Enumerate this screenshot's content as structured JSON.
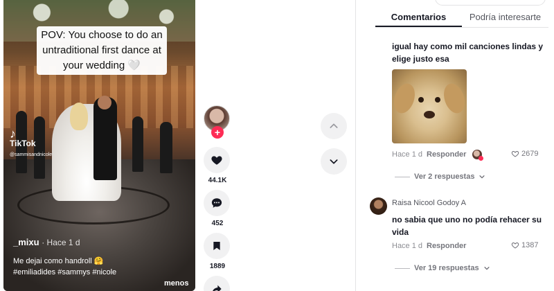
{
  "video": {
    "overlay_caption": "POV: You choose to do an untraditional first dance at your wedding 🤍",
    "watermark_brand": "TikTok",
    "watermark_handle": "@sammisandnicole",
    "author": "_mixu",
    "posted": "· Hace 1 d",
    "description_line1": "Me dejai como handroll 🤗",
    "description_line2": "#emiliadides #sammys #nicole",
    "more_label": "menos"
  },
  "actions": {
    "follow_badge": "+",
    "likes": "44.1K",
    "comments": "452",
    "saves": "1889"
  },
  "nav": {
    "up_icon": "chevron-up-icon",
    "down_icon": "chevron-down-icon"
  },
  "tabs": [
    {
      "label": "Comentarios"
    },
    {
      "label": "Podría interesarte"
    }
  ],
  "comments": [
    {
      "text": "igual hay como mil canciones lindas y elige justo esa",
      "image": "puppy-photo",
      "time": "Hace 1 d",
      "reply_label": "Responder",
      "likes": "2679",
      "view_replies": "Ver 2 respuestas"
    },
    {
      "username": "Raisa Nicool Godoy A",
      "text": "no sabia que uno no podía rehacer su vida",
      "time": "Hace 1 d",
      "reply_label": "Responder",
      "likes": "1387",
      "view_replies": "Ver 19 respuestas"
    }
  ],
  "colors": {
    "accent": "#fe2c55",
    "text": "#161823",
    "button_bg": "#f1f1f2"
  }
}
